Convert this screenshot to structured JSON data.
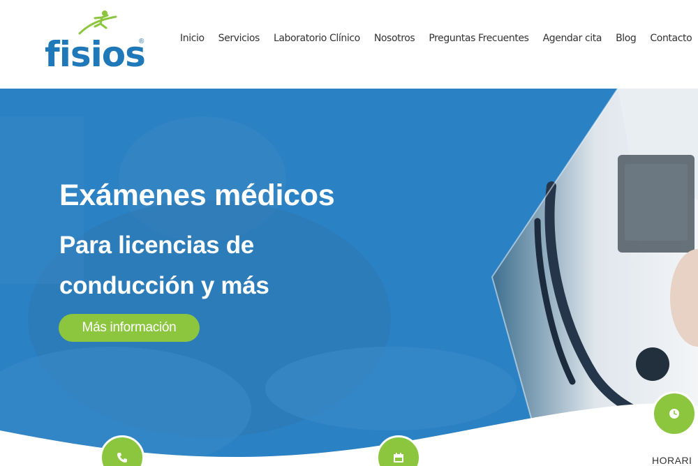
{
  "brand": {
    "name": "fisios",
    "registered_mark": "®",
    "primary_color": "#1f78b8",
    "accent_color": "#8cc63f"
  },
  "nav": {
    "items": [
      {
        "label": "Inicio"
      },
      {
        "label": "Servicios"
      },
      {
        "label": "Laboratorio Clínico"
      },
      {
        "label": "Nosotros"
      },
      {
        "label": "Preguntas Frecuentes"
      },
      {
        "label": "Agendar cita"
      },
      {
        "label": "Blog"
      },
      {
        "label": "Contacto"
      }
    ]
  },
  "hero": {
    "title": "Exámenes médicos",
    "subtitle": "Para licencias de conducción y más",
    "button_label": "Más información",
    "overlay_color": "#2a81c4"
  },
  "info_strip": {
    "items": [
      {
        "icon": "phone-icon"
      },
      {
        "icon": "calendar-icon"
      },
      {
        "icon": "clock-icon",
        "label": "HORARI"
      }
    ]
  }
}
